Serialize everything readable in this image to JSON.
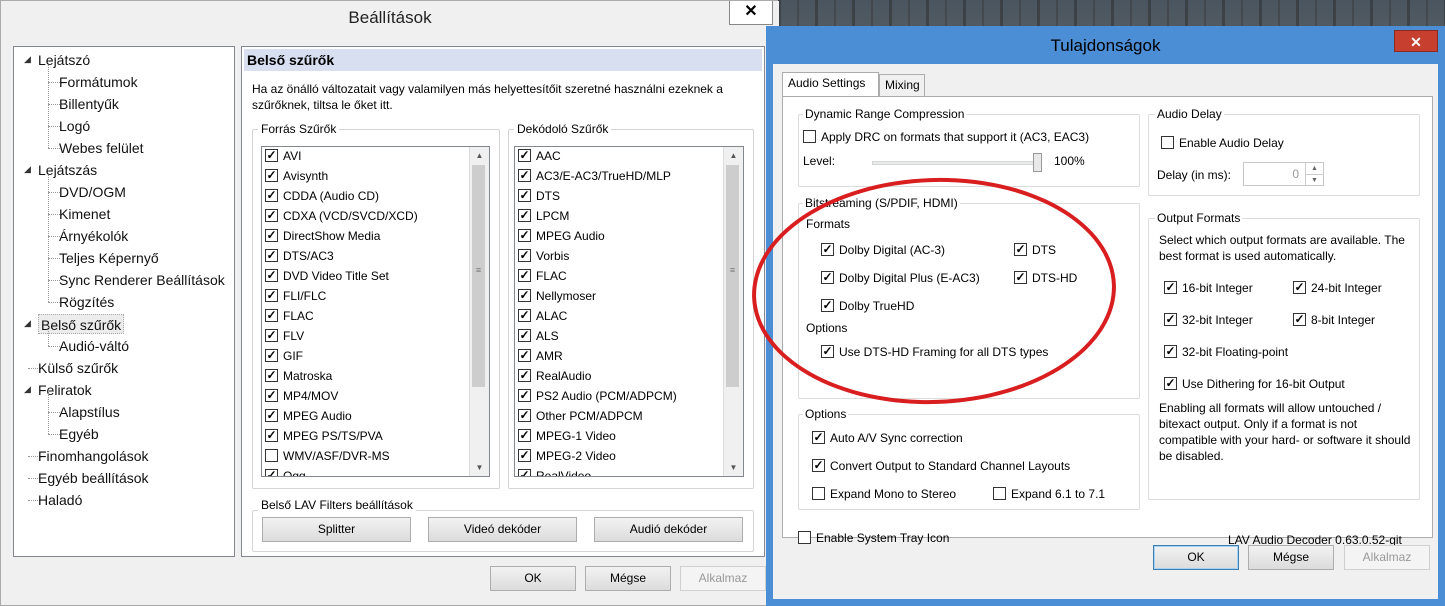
{
  "background": {
    "colors": [
      "#4a5560",
      "#a56a3a",
      "#3a2a22"
    ]
  },
  "settings_window": {
    "title": "Beállítások",
    "close_glyph": "✕",
    "tree": [
      {
        "label": "Lejátszó",
        "level": 0,
        "toggle": "◢"
      },
      {
        "label": "Formátumok",
        "level": 1
      },
      {
        "label": "Billentyűk",
        "level": 1
      },
      {
        "label": "Logó",
        "level": 1
      },
      {
        "label": "Webes felület",
        "level": 1
      },
      {
        "label": "Lejátszás",
        "level": 0,
        "toggle": "◢"
      },
      {
        "label": "DVD/OGM",
        "level": 1
      },
      {
        "label": "Kimenet",
        "level": 1
      },
      {
        "label": "Árnyékolók",
        "level": 1
      },
      {
        "label": "Teljes Képernyő",
        "level": 1
      },
      {
        "label": "Sync Renderer Beállítások",
        "level": 1
      },
      {
        "label": "Rögzítés",
        "level": 1
      },
      {
        "label": "Belső szűrők",
        "level": 0,
        "toggle": "◢",
        "selected": true
      },
      {
        "label": "Audió-váltó",
        "level": 1
      },
      {
        "label": "Külső szűrők",
        "level": 0
      },
      {
        "label": "Feliratok",
        "level": 0,
        "toggle": "◢"
      },
      {
        "label": "Alapstílus",
        "level": 1
      },
      {
        "label": "Egyéb",
        "level": 1
      },
      {
        "label": "Finomhangolások",
        "level": 0
      },
      {
        "label": "Egyéb beállítások",
        "level": 0
      },
      {
        "label": "Haladó",
        "level": 0
      }
    ],
    "panel": {
      "title": "Belső szűrők",
      "description": "Ha az önálló változatait vagy valamilyen más helyettesítőit szeretné használni ezeknek a szűrőknek, tiltsa le őket itt.",
      "source_group": "Forrás Szűrők",
      "source_items": [
        {
          "label": "AVI",
          "checked": true
        },
        {
          "label": "Avisynth",
          "checked": true
        },
        {
          "label": "CDDA (Audio CD)",
          "checked": true
        },
        {
          "label": "CDXA (VCD/SVCD/XCD)",
          "checked": true
        },
        {
          "label": "DirectShow Media",
          "checked": true
        },
        {
          "label": "DTS/AC3",
          "checked": true
        },
        {
          "label": "DVD Video Title Set",
          "checked": true
        },
        {
          "label": "FLI/FLC",
          "checked": true
        },
        {
          "label": "FLAC",
          "checked": true
        },
        {
          "label": "FLV",
          "checked": true
        },
        {
          "label": "GIF",
          "checked": true
        },
        {
          "label": "Matroska",
          "checked": true
        },
        {
          "label": "MP4/MOV",
          "checked": true
        },
        {
          "label": "MPEG Audio",
          "checked": true
        },
        {
          "label": "MPEG PS/TS/PVA",
          "checked": true
        },
        {
          "label": "WMV/ASF/DVR-MS",
          "checked": false
        },
        {
          "label": "Ogg",
          "checked": true
        }
      ],
      "decoder_group": "Dekódoló Szűrők",
      "decoder_items": [
        {
          "label": "AAC",
          "checked": true
        },
        {
          "label": "AC3/E-AC3/TrueHD/MLP",
          "checked": true
        },
        {
          "label": "DTS",
          "checked": true
        },
        {
          "label": "LPCM",
          "checked": true
        },
        {
          "label": "MPEG Audio",
          "checked": true
        },
        {
          "label": "Vorbis",
          "checked": true
        },
        {
          "label": "FLAC",
          "checked": true
        },
        {
          "label": "Nellymoser",
          "checked": true
        },
        {
          "label": "ALAC",
          "checked": true
        },
        {
          "label": "ALS",
          "checked": true
        },
        {
          "label": "AMR",
          "checked": true
        },
        {
          "label": "RealAudio",
          "checked": true
        },
        {
          "label": "PS2 Audio (PCM/ADPCM)",
          "checked": true
        },
        {
          "label": "Other PCM/ADPCM",
          "checked": true
        },
        {
          "label": "MPEG-1 Video",
          "checked": true
        },
        {
          "label": "MPEG-2 Video",
          "checked": true
        },
        {
          "label": "RealVideo",
          "checked": true
        }
      ],
      "lav_group": "Belső LAV Filters beállítások",
      "lav_buttons": [
        "Splitter",
        "Videó dekóder",
        "Audió dekóder"
      ]
    },
    "buttons": {
      "ok": "OK",
      "cancel": "Mégse",
      "apply": "Alkalmaz"
    }
  },
  "props_window": {
    "title": "Tulajdonságok",
    "close_glyph": "✕",
    "tabs": [
      "Audio Settings",
      "Mixing"
    ],
    "drc": {
      "group": "Dynamic Range Compression",
      "apply_label": "Apply DRC on formats that support it (AC3, EAC3)",
      "apply_checked": false,
      "level_label": "Level:",
      "level_value": "100%",
      "level_fraction": 1.0
    },
    "delay": {
      "group": "Audio Delay",
      "enable_label": "Enable Audio Delay",
      "enable_checked": false,
      "ms_label": "Delay (in ms):",
      "ms_value": "0"
    },
    "bitstream": {
      "group": "Bitstreaming (S/PDIF, HDMI)",
      "formats_label": "Formats",
      "formats": [
        {
          "label": "Dolby Digital (AC-3)",
          "checked": true
        },
        {
          "label": "DTS",
          "checked": true
        },
        {
          "label": "Dolby Digital Plus (E-AC3)",
          "checked": true
        },
        {
          "label": "DTS-HD",
          "checked": true
        },
        {
          "label": "Dolby TrueHD",
          "checked": true
        }
      ],
      "options_label": "Options",
      "dtshd_framing": "Use DTS-HD Framing for all DTS types",
      "dtshd_framing_checked": true
    },
    "output": {
      "group": "Output Formats",
      "description": "Select which output formats are available. The best format is used automatically.",
      "formats": [
        {
          "label": "16-bit Integer",
          "checked": true
        },
        {
          "label": "24-bit Integer",
          "checked": true
        },
        {
          "label": "32-bit Integer",
          "checked": true
        },
        {
          "label": "8-bit Integer",
          "checked": true
        },
        {
          "label": "32-bit Floating-point",
          "checked": true
        }
      ],
      "dithering": "Use Dithering for 16-bit Output",
      "dithering_checked": true,
      "note": "Enabling all formats will allow untouched / bitexact output. Only if a format is not compatible with your hard- or software it should be disabled."
    },
    "options": {
      "group": "Options",
      "items": [
        {
          "label": "Auto A/V Sync correction",
          "checked": true
        },
        {
          "label": "Convert Output to Standard Channel Layouts",
          "checked": true
        },
        {
          "label": "Expand Mono to Stereo",
          "checked": false
        },
        {
          "label": "Expand 6.1 to 7.1",
          "checked": false
        }
      ]
    },
    "tray": {
      "label": "Enable System Tray Icon",
      "checked": false
    },
    "version": "LAV Audio Decoder 0.63.0.52-git",
    "buttons": {
      "ok": "OK",
      "cancel": "Mégse",
      "apply": "Alkalmaz"
    }
  },
  "annotation": {
    "color": "#d81e1e"
  }
}
